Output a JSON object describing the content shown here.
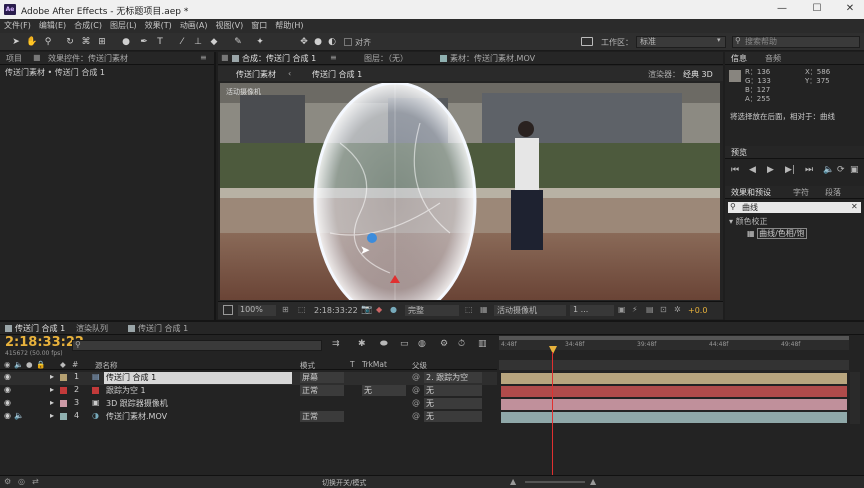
{
  "window": {
    "title": "Adobe After Effects - 无标题项目.aep *",
    "logo_text": "Ae",
    "minimize": "—",
    "maximize": "☐",
    "close": "✕"
  },
  "menu": [
    "文件(F)",
    "编辑(E)",
    "合成(C)",
    "图层(L)",
    "效果(T)",
    "动画(A)",
    "视图(V)",
    "窗口",
    "帮助(H)"
  ],
  "toolbar": {
    "align_label": "对齐",
    "workspace_label": "工作区：",
    "workspace_value": "标准",
    "search_placeholder": "搜索帮助"
  },
  "left_panel": {
    "tab_project": "项目",
    "tab_effects": "效果控件：传送门素材",
    "tab_effects_menu": "≡",
    "breadcrumb": "传送门素材 • 传送门 合成 1"
  },
  "viewer": {
    "tab_comp": "合成：传送门 合成 1",
    "tab_comp_menu": "≡",
    "tab_layer": "图层：（无）",
    "tab_footage": "素材：传送门素材.MOV",
    "subtab_1": "传送门素材",
    "subtab_2": "传送门 合成 1",
    "renderer_label": "渲染器：",
    "renderer_value": "经典 3D",
    "camera_label": "活动摄像机",
    "bottom": {
      "zoom": "100%",
      "timecode": "2:18:33:22",
      "quality": "完整",
      "camera": "活动摄像机",
      "views": "1 ...",
      "exposure": "+0.0"
    }
  },
  "info": {
    "tab_info": "信息",
    "tab_audio": "音频",
    "r": "R：136",
    "g": "G：133",
    "b": "B：127",
    "a": "A：255",
    "x": "X：586",
    "y": "Y：375",
    "hint": "将选择放在后面，相对于：曲线"
  },
  "preview": {
    "tab": "预览"
  },
  "effects": {
    "tab_effects": "效果和预设",
    "tab_char": "字符",
    "tab_para": "段落",
    "search_value": "曲线",
    "category": "颜色校正",
    "item": "曲线/色相/饱"
  },
  "timeline": {
    "tab_comp": "传送门 合成 1",
    "tab_render": "渲染队列",
    "tab_comp2": "传送门 合成 1",
    "timecode": "2:18:33:22",
    "frame_info": "415672 (50.00 fps)",
    "col_name": "源名称",
    "col_mode": "模式",
    "col_t": "T",
    "col_trkmat": "TrkMat",
    "col_parent": "父级",
    "ruler": [
      "4:48f",
      "34:48f",
      "39:48f",
      "44:48f",
      "49:48f"
    ],
    "toggle_label": "切换开关/模式",
    "layers": [
      {
        "num": "1",
        "name": "传送门 合成 1",
        "mode": "屏幕",
        "trkmat": "",
        "parent": "2. 跟踪为空",
        "color": "#b5a071",
        "bar": "#b8a57e"
      },
      {
        "num": "2",
        "name": "跟踪为空 1",
        "mode": "正常",
        "trkmat": "无",
        "parent": "无",
        "color": "#c23a3a",
        "bar": "#b04b4b"
      },
      {
        "num": "3",
        "name": "3D 跟踪器摄像机",
        "mode": "",
        "trkmat": "",
        "parent": "无",
        "color": "#cc9aa6",
        "bar": "#c0909b"
      },
      {
        "num": "4",
        "name": "传送门素材.MOV",
        "mode": "正常",
        "trkmat": "",
        "parent": "无",
        "color": "#8fb0b0",
        "bar": "#8fa8a9"
      }
    ]
  }
}
